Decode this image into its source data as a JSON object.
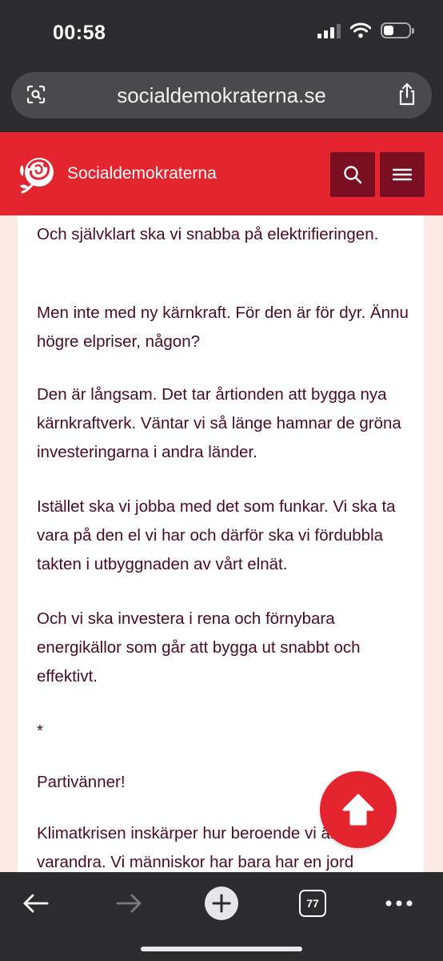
{
  "status_bar": {
    "time": "00:58"
  },
  "browser": {
    "url": "socialdemokraterna.se",
    "tabs_count": "77"
  },
  "site": {
    "brand": "Socialdemokraterna"
  },
  "article": {
    "paragraphs": [
      "Och självklart ska vi snabba på elektrifieringen.",
      "Men inte med ny kärnkraft. För den är för dyr. Ännu högre elpriser, någon?",
      "Den är långsam. Det tar årtionden att bygga nya kärnkraftverk. Väntar vi så länge hamnar de gröna investeringarna i andra länder.",
      "Istället ska vi jobba med det som funkar. Vi ska ta vara på den el vi har och därför ska vi fördubbla takten i utbyggnaden av vårt elnät.",
      "Och vi ska investera i rena och förnybara energikällor som går att bygga ut snabbt och effektivt.",
      "*",
      "Partivänner!",
      "Klimatkrisen inskärper hur beroende vi är av varandra. Vi människor har bara har en jord"
    ]
  },
  "colors": {
    "brand_red": "#e4242e",
    "dark_red": "#7a0f22",
    "text": "#4a0c1e",
    "chrome": "#2c2c2e"
  },
  "icons": {
    "lens": "lens-icon",
    "share": "share-icon",
    "logo": "rose-logo-icon",
    "search": "search-icon",
    "menu": "hamburger-icon",
    "scroll_top": "arrow-up-icon",
    "back": "arrow-left-icon",
    "forward": "arrow-right-icon",
    "new_tab": "plus-icon",
    "more": "more-dots-icon"
  }
}
